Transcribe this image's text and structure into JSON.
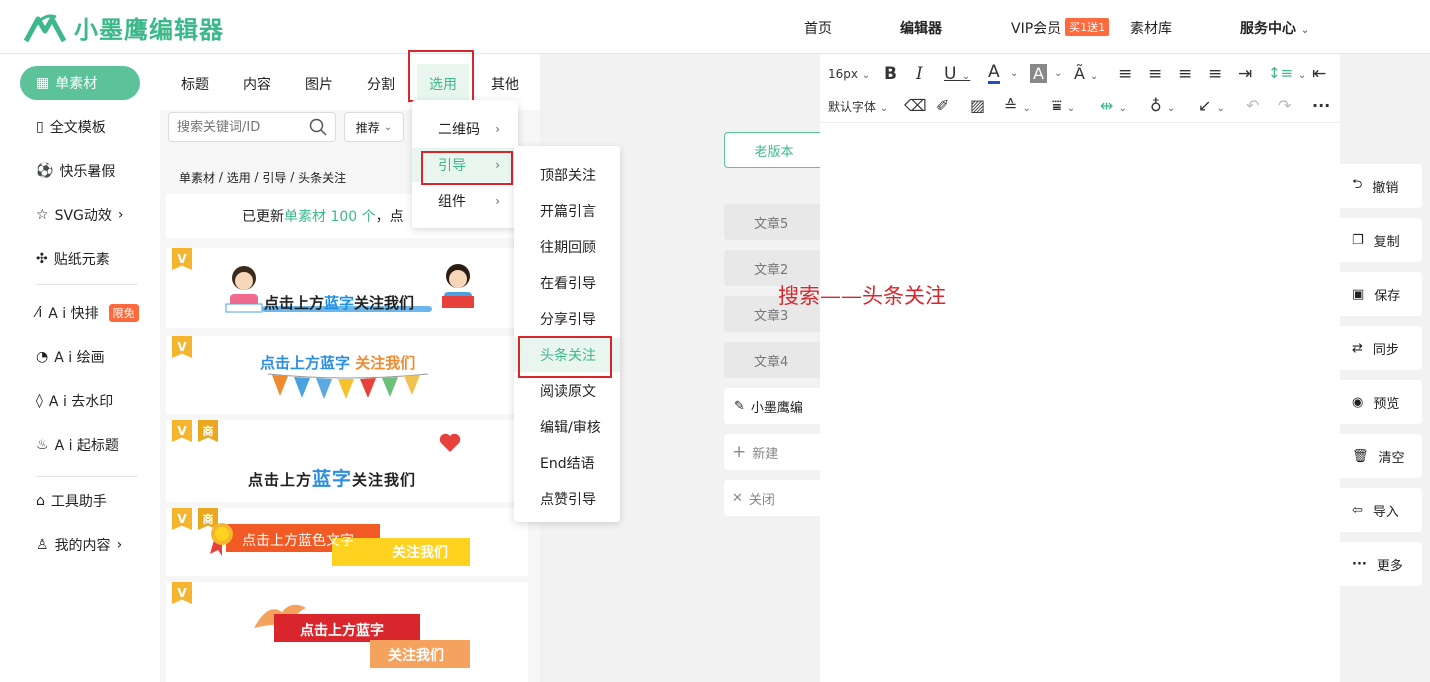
{
  "header": {
    "logo_text": "小墨鹰编辑器",
    "nav": [
      {
        "label": "首页"
      },
      {
        "label": "编辑器"
      },
      {
        "label": "VIP会员",
        "badge": "买1送1"
      },
      {
        "label": "素材库"
      },
      {
        "label": "服务中心"
      }
    ]
  },
  "sidebar": {
    "items": [
      {
        "label": "单素材",
        "icon": "grid-icon"
      },
      {
        "label": "全文模板",
        "icon": "template-icon"
      },
      {
        "label": "快乐暑假",
        "icon": "ball-icon"
      },
      {
        "label": "SVG动效",
        "icon": "star-icon"
      },
      {
        "label": "贴纸元素",
        "icon": "puzzle-icon"
      },
      {
        "label": "A i 快排",
        "icon": "ai-icon",
        "badge": "限免"
      },
      {
        "label": "A i 绘画",
        "icon": "palette-icon"
      },
      {
        "label": "A i 去水印",
        "icon": "drop-icon"
      },
      {
        "label": "A i 起标题",
        "icon": "fire-icon"
      },
      {
        "label": "工具助手",
        "icon": "tool-icon"
      },
      {
        "label": "我的内容",
        "icon": "user-icon"
      }
    ]
  },
  "panel": {
    "tabs": [
      "标题",
      "内容",
      "图片",
      "分割",
      "选用",
      "其他"
    ],
    "search_placeholder": "搜索关键词/ID",
    "sort_label": "推荐",
    "breadcrumb": [
      "单素材",
      "选用",
      "引导",
      "头条关注"
    ],
    "notice_prefix": "已更新",
    "notice_highlight": "单素材 100 个",
    "notice_suffix": "，点",
    "cards": [
      {
        "text_a": "点击上方",
        "text_b": "蓝字",
        "text_c": "关注我们"
      },
      {
        "text_a": "点击上方蓝字",
        "text_b": "关注我们"
      },
      {
        "text_a": "点击上方",
        "text_b": "蓝字",
        "text_c": "关注我们",
        "badge": "商"
      },
      {
        "text_a": "点击上方蓝色文字",
        "text_b": "关注我们",
        "badge": "商"
      },
      {
        "text_a": "点击上方蓝字",
        "text_b": "关注我们"
      }
    ],
    "v_badge": "V"
  },
  "menu_level1": [
    "二维码",
    "引导",
    "组件"
  ],
  "menu_level2": [
    "顶部关注",
    "开篇引言",
    "往期回顾",
    "在看引导",
    "分享引导",
    "头条关注",
    "阅读原文",
    "编辑/审核",
    "End结语",
    "点赞引导"
  ],
  "articles": {
    "old_version": "老版本",
    "items": [
      "文章5",
      "文章2",
      "文章3",
      "文章4"
    ],
    "current": "小墨鹰编",
    "new_label": "新建",
    "close_label": "关闭"
  },
  "toolbar": {
    "font_size": "16px",
    "font_family": "默认字体"
  },
  "annotation": "搜索——头条关注",
  "right_actions": [
    {
      "label": "撤销",
      "icon": "undo-icon"
    },
    {
      "label": "复制",
      "icon": "copy-icon"
    },
    {
      "label": "保存",
      "icon": "save-icon"
    },
    {
      "label": "同步",
      "icon": "sync-icon"
    },
    {
      "label": "预览",
      "icon": "eye-icon"
    },
    {
      "label": "清空",
      "icon": "trash-icon"
    },
    {
      "label": "导入",
      "icon": "import-icon"
    },
    {
      "label": "更多",
      "icon": "more-icon"
    }
  ],
  "colors": {
    "brand": "#3cb88a",
    "accent": "#ff6a3d",
    "highlight": "#d9262c"
  }
}
